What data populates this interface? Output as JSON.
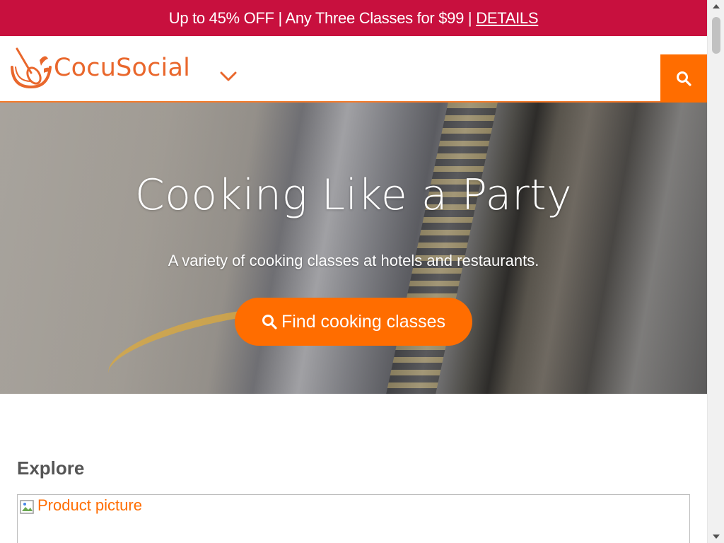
{
  "promo": {
    "text": "Up to 45% OFF | Any Three Classes for $99 |",
    "link": "DETAILS",
    "bg_color": "#c8103e"
  },
  "header": {
    "logo_text": "CocuSocial",
    "logo_icon": "whisk-bowl-icon",
    "menu_icon": "chevron-down-icon",
    "search_icon": "search-icon",
    "accent_color": "#ff6d00"
  },
  "hero": {
    "title": "Cooking Like a Party",
    "subtitle": "A variety of cooking classes at hotels and restaurants.",
    "cta_label": "Find cooking classes",
    "cta_icon": "search-icon"
  },
  "explore": {
    "title": "Explore",
    "product_image_alt": "Product picture"
  }
}
